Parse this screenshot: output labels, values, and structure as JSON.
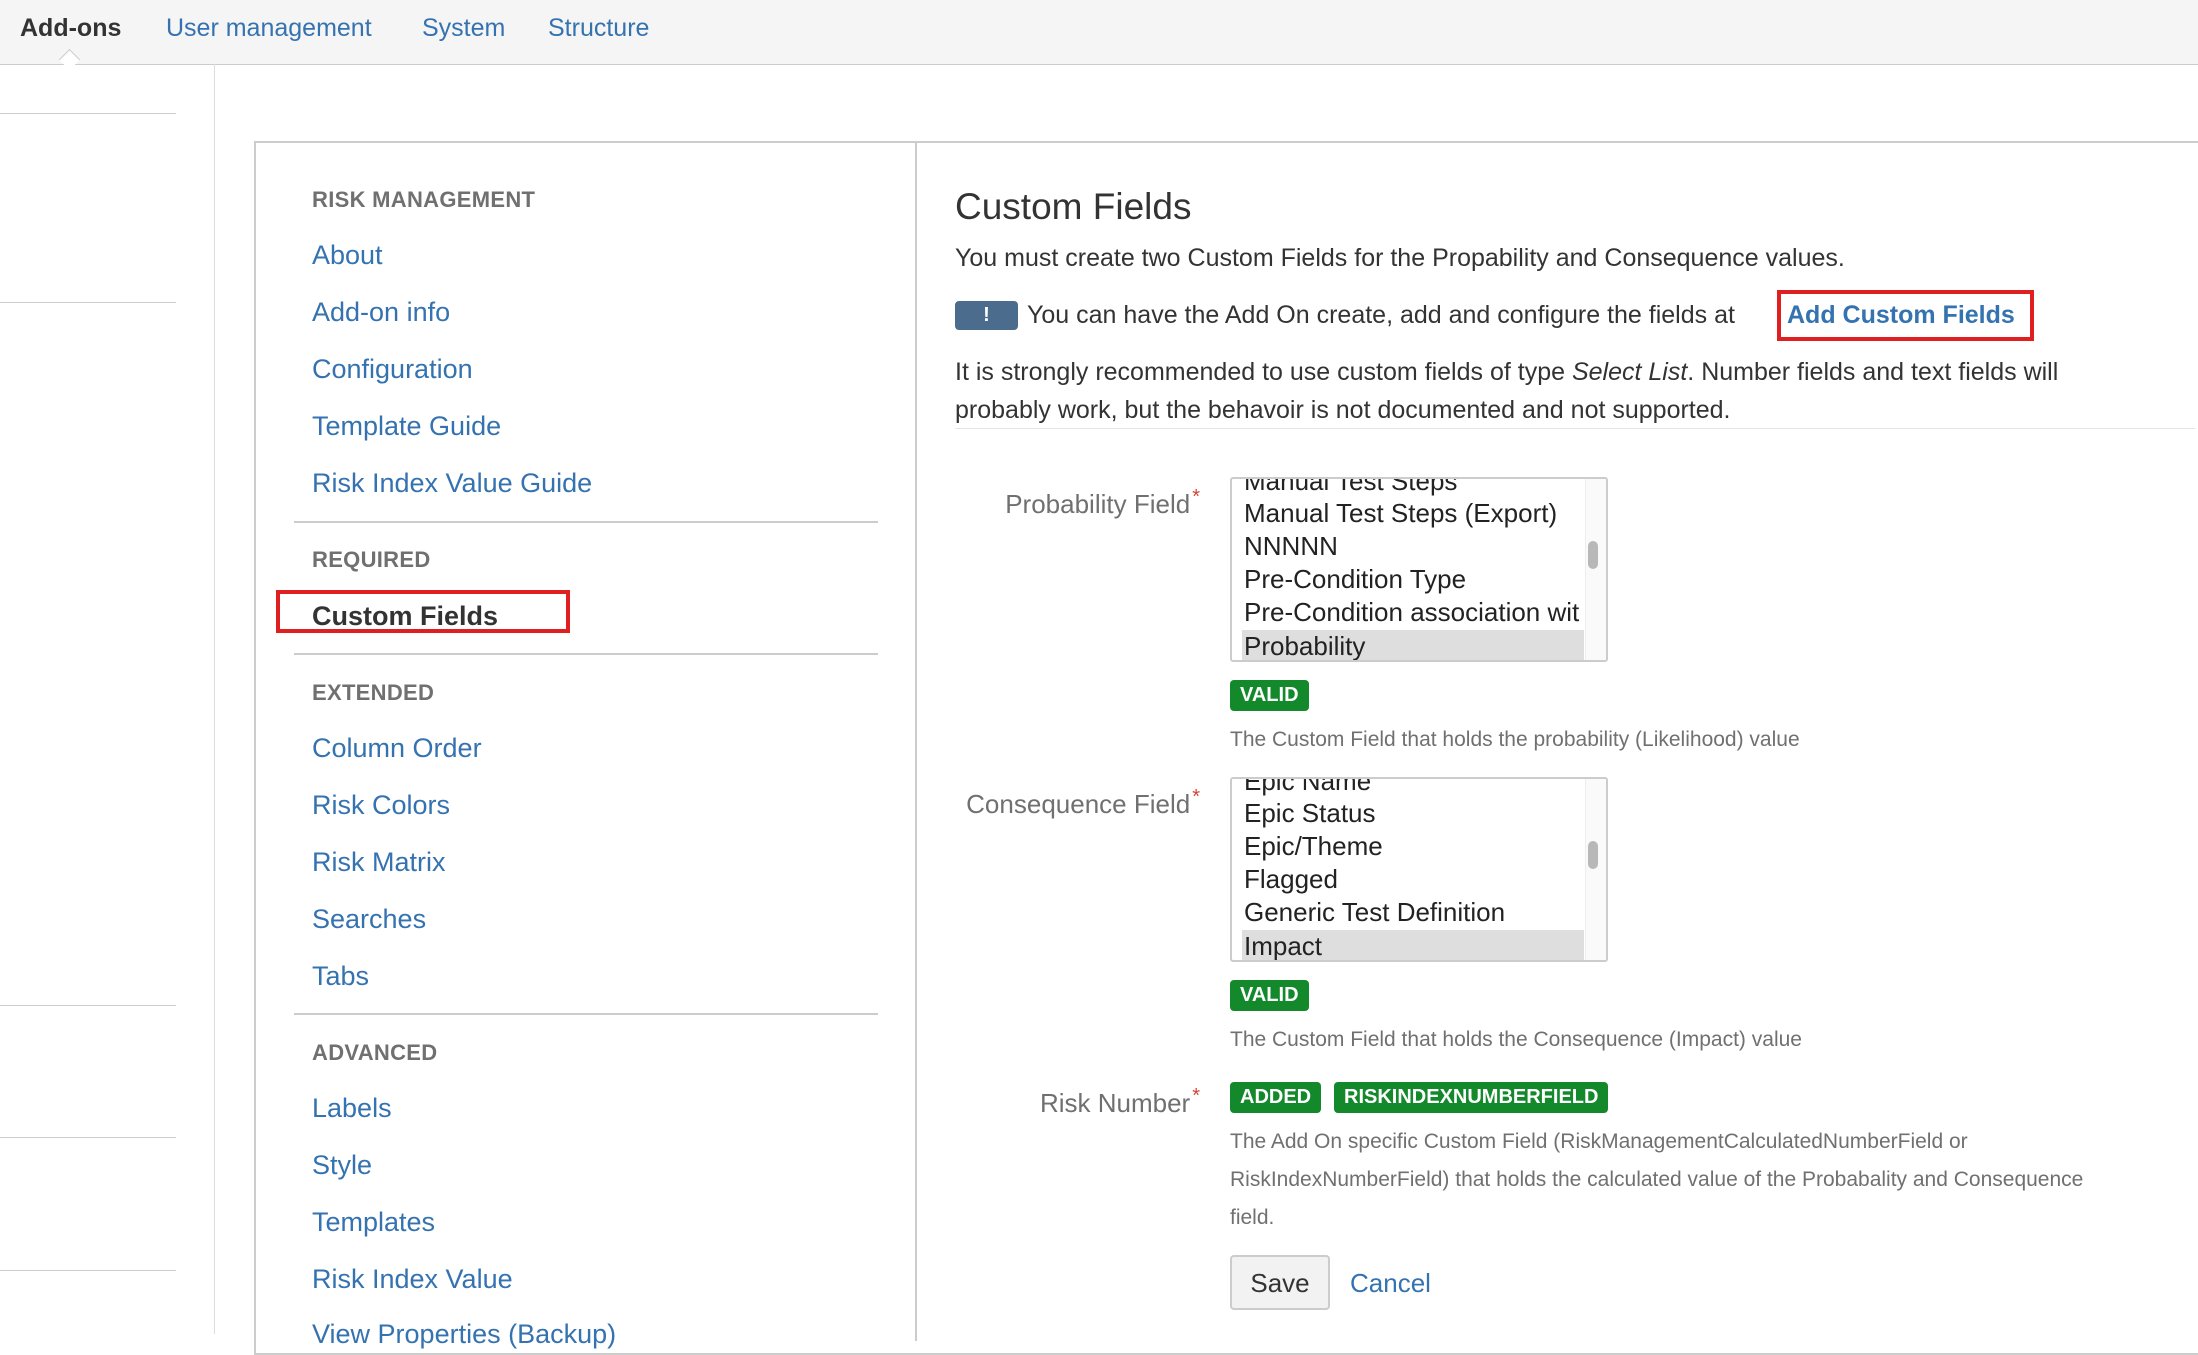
{
  "topnav": {
    "tabs": [
      {
        "label": "Add-ons",
        "active": true
      },
      {
        "label": "User management"
      },
      {
        "label": "System"
      },
      {
        "label": "Structure"
      }
    ]
  },
  "sidebar": {
    "sections": [
      {
        "heading": "RISK MANAGEMENT",
        "items": [
          "About",
          "Add-on info",
          "Configuration",
          "Template Guide",
          "Risk Index Value Guide"
        ]
      },
      {
        "heading": "REQUIRED",
        "items": [
          "Custom Fields"
        ]
      },
      {
        "heading": "EXTENDED",
        "items": [
          "Column Order",
          "Risk Colors",
          "Risk Matrix",
          "Searches",
          "Tabs"
        ]
      },
      {
        "heading": "ADVANCED",
        "items": [
          "Labels",
          "Style",
          "Templates",
          "Risk Index Value",
          "View Properties (Backup)"
        ]
      }
    ],
    "current": "Custom Fields"
  },
  "main": {
    "title": "Custom Fields",
    "intro": "You must create two Custom Fields for the Propability and Consequence values.",
    "notice_badge": "!",
    "notice_text": "You can have the Add On create, add and configure the fields at",
    "notice_link": "Add Custom Fields",
    "recommend_pre": "It is strongly recommended to use custom fields of type ",
    "recommend_em": "Select List",
    "recommend_post": ". Number fields and text fields will",
    "recommend_line2": "probably work, but the behavoir is not documented and not supported.",
    "probability": {
      "label": "Probability Field",
      "required_mark": "*",
      "options": [
        "Manual Test Steps",
        "Manual Test Steps (Export)",
        "NNNNN",
        "Pre-Condition Type",
        "Pre-Condition association wit",
        "Probability"
      ],
      "selected": "Probability",
      "status": "VALID",
      "description": "The Custom Field that holds the probability (Likelihood) value"
    },
    "consequence": {
      "label": "Consequence Field",
      "required_mark": "*",
      "options": [
        "Epic Name",
        "Epic Status",
        "Epic/Theme",
        "Flagged",
        "Generic Test Definition",
        "Impact"
      ],
      "selected": "Impact",
      "status": "VALID",
      "description": "The Custom Field that holds the Consequence (Impact) value"
    },
    "risk_number": {
      "label": "Risk Number",
      "required_mark": "*",
      "status": "ADDED",
      "field_key": "RISKINDEXNUMBERFIELD",
      "description_lines": [
        "The Add On specific Custom Field (RiskManagementCalculatedNumberField or",
        "RiskIndexNumberField) that holds the calculated value of the Probabality and Consequence",
        "field."
      ]
    },
    "save_label": "Save",
    "cancel_label": "Cancel"
  },
  "colors": {
    "link": "#3572b0",
    "valid": "#14892c",
    "highlight": "#e02020"
  }
}
